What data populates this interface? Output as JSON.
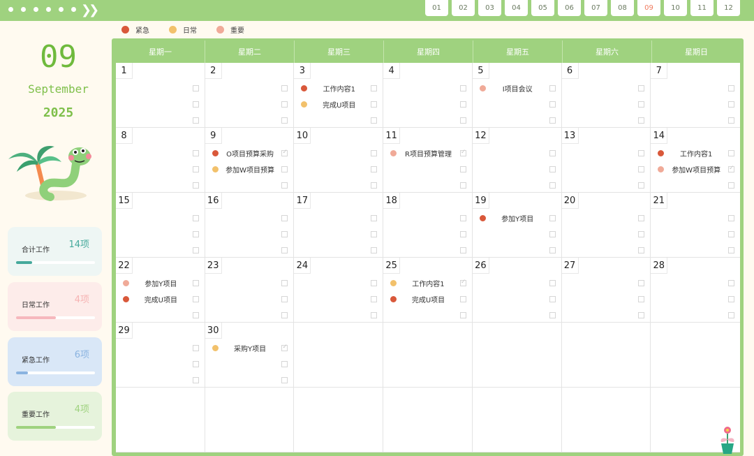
{
  "topbar": {
    "month_tabs": [
      "01",
      "02",
      "03",
      "04",
      "05",
      "06",
      "07",
      "08",
      "09",
      "10",
      "11",
      "12"
    ],
    "active_tab": "09"
  },
  "legend": [
    {
      "label": "紧急",
      "color": "#d9583a"
    },
    {
      "label": "日常",
      "color": "#f2c16b"
    },
    {
      "label": "重要",
      "color": "#f0aa98"
    }
  ],
  "header": {
    "month": "09",
    "month_name": "September",
    "year": "2025"
  },
  "stats": [
    {
      "label": "合计工作",
      "value": "14项",
      "value_color": "#45a99b",
      "bg": "#eef6f4",
      "bar_color": "#45a99b",
      "progress": 0.2
    },
    {
      "label": "日常工作",
      "value": "4项",
      "value_color": "#f6b3b3",
      "bg": "#fdecea",
      "bar_color": "#f6b7bd",
      "progress": 0.5
    },
    {
      "label": "紧急工作",
      "value": "6项",
      "value_color": "#8ab3e0",
      "bg": "#d9e7f7",
      "bar_color": "#8ab3e0",
      "progress": 0.15
    },
    {
      "label": "重要工作",
      "value": "4项",
      "value_color": "#9fd27f",
      "bg": "#e6f3dc",
      "bar_color": "#9fd27f",
      "progress": 0.5
    }
  ],
  "weekdays": [
    "星期一",
    "星期二",
    "星期三",
    "星期四",
    "星期五",
    "星期六",
    "星期日"
  ],
  "priority_colors": {
    "urgent": "#d9583a",
    "daily": "#f2c16b",
    "important": "#f0aa98"
  },
  "days": [
    {
      "day": "1",
      "tasks": []
    },
    {
      "day": "2",
      "tasks": []
    },
    {
      "day": "3",
      "tasks": [
        {
          "text": "工作内容1",
          "type": "urgent",
          "done": false
        },
        {
          "text": "完成U项目",
          "type": "daily",
          "done": false
        }
      ]
    },
    {
      "day": "4",
      "tasks": []
    },
    {
      "day": "5",
      "tasks": [
        {
          "text": "I项目会议",
          "type": "important",
          "done": false
        }
      ]
    },
    {
      "day": "6",
      "tasks": []
    },
    {
      "day": "7",
      "tasks": []
    },
    {
      "day": "8",
      "tasks": []
    },
    {
      "day": "9",
      "tasks": [
        {
          "text": "O项目预算采购",
          "type": "urgent",
          "done": true
        },
        {
          "text": "参加W项目预算",
          "type": "daily",
          "done": false
        }
      ]
    },
    {
      "day": "10",
      "tasks": []
    },
    {
      "day": "11",
      "tasks": [
        {
          "text": "R项目预算管理",
          "type": "important",
          "done": true
        }
      ]
    },
    {
      "day": "12",
      "tasks": []
    },
    {
      "day": "13",
      "tasks": []
    },
    {
      "day": "14",
      "tasks": [
        {
          "text": "工作内容1",
          "type": "urgent",
          "done": false
        },
        {
          "text": "参加W项目预算",
          "type": "important",
          "done": true
        }
      ]
    },
    {
      "day": "15",
      "tasks": []
    },
    {
      "day": "16",
      "tasks": []
    },
    {
      "day": "17",
      "tasks": []
    },
    {
      "day": "18",
      "tasks": []
    },
    {
      "day": "19",
      "tasks": [
        {
          "text": "参加Y项目",
          "type": "urgent",
          "done": false
        }
      ]
    },
    {
      "day": "20",
      "tasks": []
    },
    {
      "day": "21",
      "tasks": []
    },
    {
      "day": "22",
      "tasks": [
        {
          "text": "参加Y项目",
          "type": "important",
          "done": false
        },
        {
          "text": "完成U项目",
          "type": "urgent",
          "done": false
        }
      ]
    },
    {
      "day": "23",
      "tasks": []
    },
    {
      "day": "24",
      "tasks": []
    },
    {
      "day": "25",
      "tasks": [
        {
          "text": "工作内容1",
          "type": "daily",
          "done": true
        },
        {
          "text": "完成U项目",
          "type": "urgent",
          "done": false
        }
      ]
    },
    {
      "day": "26",
      "tasks": []
    },
    {
      "day": "27",
      "tasks": []
    },
    {
      "day": "28",
      "tasks": []
    },
    {
      "day": "29",
      "tasks": []
    },
    {
      "day": "30",
      "tasks": [
        {
          "text": "采购Y项目",
          "type": "daily",
          "done": true
        }
      ]
    }
  ]
}
